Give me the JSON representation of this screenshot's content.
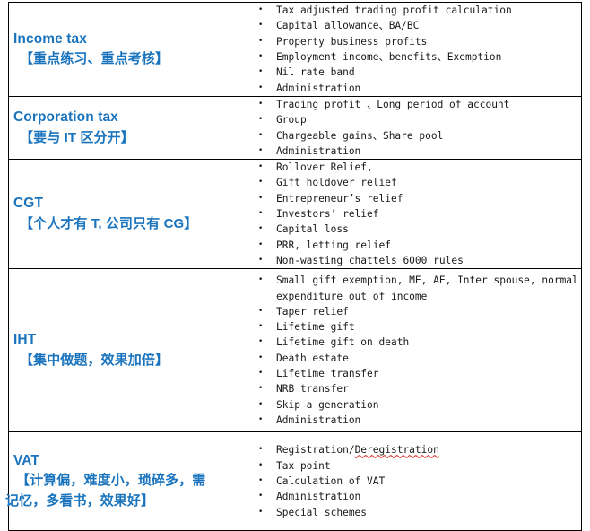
{
  "document": {
    "type": "study-plan-table",
    "accent_color": "#1a74bd",
    "text_color": "#1a1a1a",
    "border_color": "#000000",
    "background": "#ffffff"
  },
  "table": {
    "columns": [
      "topic",
      "detail"
    ],
    "rows": [
      {
        "id": "income-tax",
        "title": "Income tax",
        "note": "【重点练习、重点考核】",
        "note_lines": [
          "【重点练习、重点考核】"
        ],
        "bullets": [
          "Tax adjusted trading profit calculation",
          "Capital allowance、BA/BC",
          "Property business profits",
          "Employment income、benefits、Exemption",
          "Nil rate band",
          "Administration"
        ]
      },
      {
        "id": "corporation-tax",
        "title": "Corporation tax",
        "note": "【要与 IT 区分开】",
        "note_lines": [
          "【要与 IT 区分开】"
        ],
        "bullets": [
          "Trading profit 、Long period of account",
          "Group",
          "Chargeable gains、Share pool",
          "Administration"
        ]
      },
      {
        "id": "cgt",
        "title": "CGT",
        "note": "【个人才有 T, 公司只有 CG】",
        "note_lines": [
          "【个人才有 T, 公司只有 CG】"
        ],
        "bullets": [
          "Rollover Relief,",
          "Gift holdover relief",
          "Entrepreneur’s relief",
          "Investors’ relief",
          "Capital loss",
          "PRR, letting relief",
          "Non-wasting chattels 6000 rules"
        ]
      },
      {
        "id": "iht",
        "title": "IHT",
        "note": "【集中做题，效果加倍】",
        "note_lines": [
          "【集中做题，效果加倍】"
        ],
        "bullets": [
          "Small gift exemption, ME, AE, Inter spouse, normal expenditure out of income",
          "Taper relief",
          "Lifetime gift",
          "Lifetime gift on death",
          "Death estate",
          "Lifetime transfer",
          "NRB transfer",
          "Skip a generation",
          "Administration"
        ]
      },
      {
        "id": "vat",
        "title": "VAT",
        "note": "【计算偏，难度小，琐碎多，需记忆，多看书，效果好】",
        "note_lines": [
          "【计算偏，难度小，琐碎多，需",
          "记忆，多看书，效果好】"
        ],
        "bullets_rich": [
          {
            "prefix": "Registration/",
            "misspelled": "Deregistration",
            "suffix": ""
          },
          {
            "prefix": "Tax point",
            "misspelled": "",
            "suffix": ""
          },
          {
            "prefix": "Calculation of VAT",
            "misspelled": "",
            "suffix": ""
          },
          {
            "prefix": "Administration",
            "misspelled": "",
            "suffix": ""
          },
          {
            "prefix": "Special schemes",
            "misspelled": "",
            "suffix": ""
          }
        ],
        "bullets": [
          "Registration/Deregistration",
          "Tax point",
          "Calculation of VAT",
          "Administration",
          "Special schemes"
        ]
      }
    ]
  },
  "bullet_glyph": "•"
}
